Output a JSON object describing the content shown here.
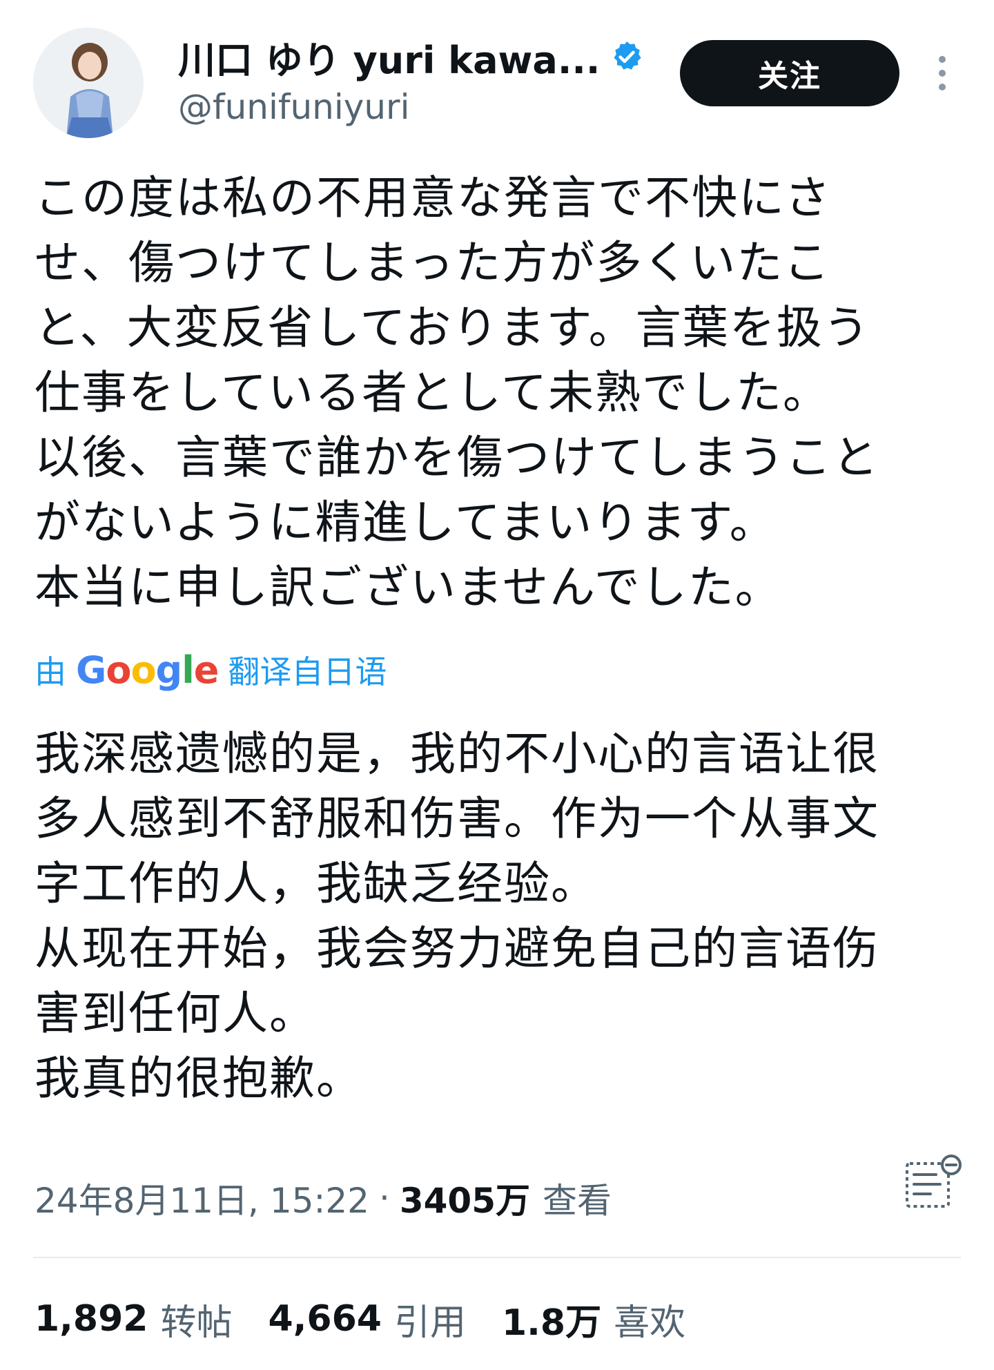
{
  "author": {
    "display_name": "川口 ゆり yuri kawa...",
    "handle": "@funifuniyuri",
    "verified": true
  },
  "actions": {
    "follow_label": "关注"
  },
  "tweet": {
    "text": "この度は私の不用意な発言で不快にさ\nせ、傷つけてしまった方が多くいたこ\nと、大変反省しております。言葉を扱う\n仕事をしている者として未熟でした。\n以後、言葉で誰かを傷つけてしまうこと\nがないように精進してまいります。\n本当に申し訳ございませんでした。",
    "translation_prefix": "由",
    "translation_provider": "Google",
    "translation_suffix": "翻译自日语",
    "translated_text": "我深感遗憾的是，我的不小心的言语让很\n多人感到不舒服和伤害。作为一个从事文\n字工作的人，我缺乏经验。\n从现在开始，我会努力避免自己的言语伤\n害到任何人。\n我真的很抱歉。"
  },
  "meta": {
    "timestamp": "24年8月11日, 15:22",
    "separator": "·",
    "views_count": "3405万",
    "views_label": "查看"
  },
  "stats": {
    "reposts_count": "1,892",
    "reposts_label": "转帖",
    "quotes_count": "4,664",
    "quotes_label": "引用",
    "likes_count": "1.8万",
    "likes_label": "喜欢"
  },
  "colors": {
    "text": "#0f1419",
    "secondary": "#536471",
    "link": "#1d9bf0",
    "verified": "#1d9bf0",
    "follow_button": "#0f1419"
  }
}
